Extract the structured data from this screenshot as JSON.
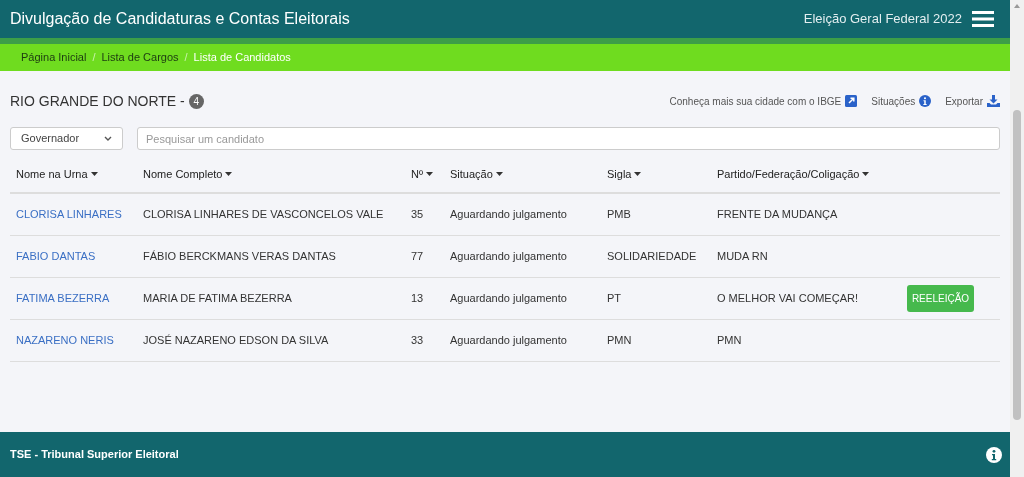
{
  "header": {
    "title": "Divulgação de Candidaturas e Contas Eleitorais",
    "election": "Eleição Geral Federal 2022"
  },
  "breadcrumb_separator": "/",
  "breadcrumb": [
    {
      "label": "Página Inicial",
      "current": false
    },
    {
      "label": "Lista de Cargos",
      "current": false
    },
    {
      "label": "Lista de Candidatos",
      "current": true
    }
  ],
  "heading": {
    "title": "RIO GRANDE DO NORTE -",
    "count": "4"
  },
  "actions": [
    {
      "label": "Conheça mais sua cidade com o IBGE",
      "kind": "external"
    },
    {
      "label": "Situações",
      "kind": "info"
    },
    {
      "label": "Exportar",
      "kind": "download"
    }
  ],
  "filter": {
    "office": "Governador",
    "placeholder": "Pesquisar um candidato"
  },
  "table": {
    "columns": [
      "Nome na Urna",
      "Nome Completo",
      "Nº",
      "Situação",
      "Sigla",
      "Partido/Federação/Coligação"
    ],
    "rows": [
      {
        "ballot_name": "CLORISA LINHARES",
        "full_name": "CLORISA LINHARES DE VASCONCELOS VALE",
        "number": "35",
        "status": "Aguardando julgamento",
        "acronym": "PMB",
        "coalition": "FRENTE DA MUDANÇA"
      },
      {
        "ballot_name": "FABIO DANTAS",
        "full_name": "FÁBIO BERCKMANS VERAS DANTAS",
        "number": "77",
        "status": "Aguardando julgamento",
        "acronym": "SOLIDARIEDADE",
        "coalition": "MUDA RN"
      },
      {
        "ballot_name": "FATIMA BEZERRA",
        "full_name": "MARIA DE FATIMA BEZERRA",
        "number": "13",
        "status": "Aguardando julgamento",
        "acronym": "PT",
        "coalition": "O MELHOR VAI COMEÇAR!",
        "badge": "REELEIÇÃO"
      },
      {
        "ballot_name": "NAZARENO NERIS",
        "full_name": "JOSÉ NAZARENO EDSON DA SILVA",
        "number": "33",
        "status": "Aguardando julgamento",
        "acronym": "PMN",
        "coalition": "PMN"
      }
    ]
  },
  "footer": {
    "text": "TSE - Tribunal Superior Eleitoral"
  }
}
